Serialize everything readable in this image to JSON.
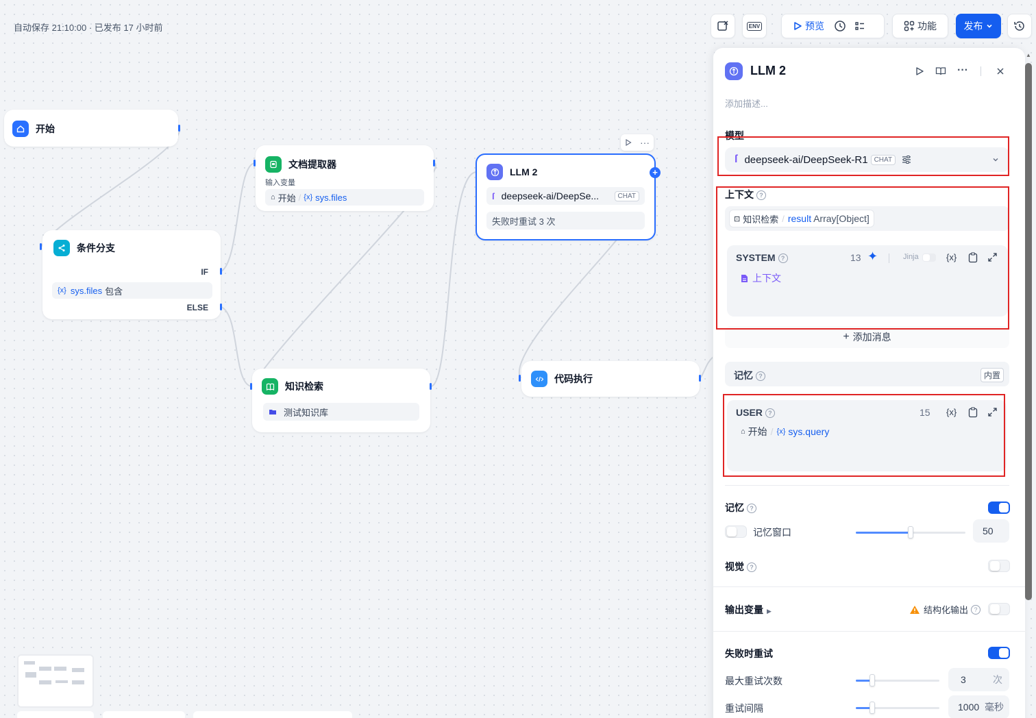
{
  "topbar": {
    "autosave": "自动保存 21:10:00 · 已发布 17 小时前",
    "env_label": "ENV",
    "preview_label": "预览",
    "features_label": "功能",
    "publish_label": "发布"
  },
  "nodes": {
    "start": {
      "title": "开始"
    },
    "condition": {
      "title": "条件分支",
      "if_label": "IF",
      "else_label": "ELSE",
      "cond_var": "sys.files",
      "cond_op": "包含"
    },
    "doc_extractor": {
      "title": "文档提取器",
      "input_label": "输入变量",
      "src_node": "开始",
      "var": "sys.files"
    },
    "llm2": {
      "title": "LLM 2",
      "model": "deepseek-ai/DeepSe...",
      "mode": "CHAT",
      "retry": "失败时重试 3 次"
    },
    "knowledge": {
      "title": "知识检索",
      "dataset": "测试知识库"
    },
    "code": {
      "title": "代码执行"
    }
  },
  "panel": {
    "title": "LLM 2",
    "description_placeholder": "添加描述...",
    "model_label": "模型",
    "model_name": "deepseek-ai/DeepSeek-R1",
    "model_mode": "CHAT",
    "context_label": "上下文",
    "context_src": "知识检索",
    "context_var": "result",
    "context_type": "Array[Object]",
    "system": {
      "role": "SYSTEM",
      "count": "13",
      "jinja": "Jinja",
      "content_var": "上下文"
    },
    "add_message": "添加消息",
    "memory_row": {
      "label": "记忆",
      "badge": "内置"
    },
    "user": {
      "role": "USER",
      "count": "15",
      "src_node": "开始",
      "var": "sys.query"
    },
    "memory": {
      "label": "记忆",
      "enabled": true,
      "window_label": "记忆窗口",
      "window_enabled": false,
      "window_value": "50",
      "window_fraction": 0.5
    },
    "vision": {
      "label": "视觉",
      "enabled": false
    },
    "output": {
      "label": "输出变量",
      "structured_label": "结构化输出",
      "structured_enabled": false
    },
    "retry": {
      "label": "失败时重试",
      "enabled": true,
      "max_label": "最大重试次数",
      "max_value": "3",
      "max_unit": "次",
      "max_fraction": 0.2,
      "interval_label": "重试间隔",
      "interval_value": "1000",
      "interval_unit": "毫秒",
      "interval_fraction": 0.2
    }
  },
  "colors": {
    "accent": "#155eef",
    "highlight_border": "#e02424",
    "canvas": "#f2f4f7"
  }
}
